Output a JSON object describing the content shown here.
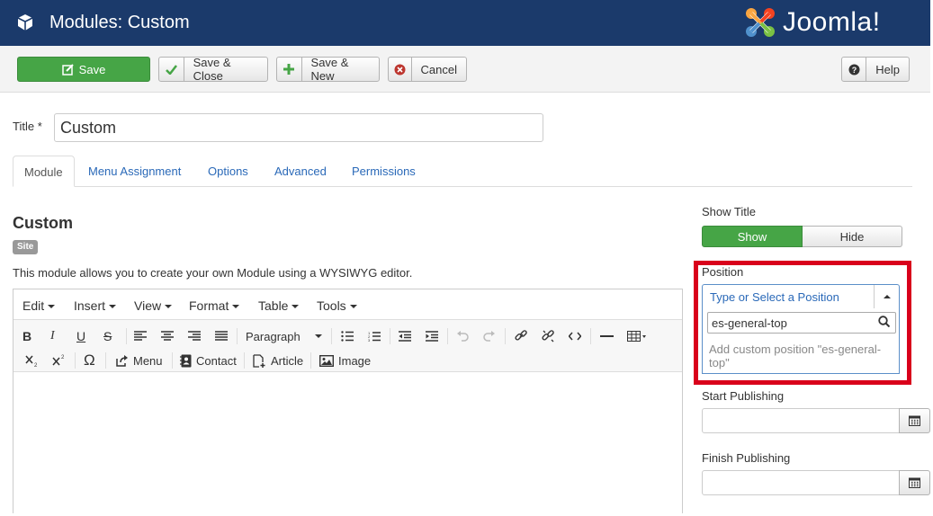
{
  "header": {
    "title": "Modules: Custom",
    "brand": "Joomla!",
    "brand_reg": "®",
    "bg_color": "#1b3a6b"
  },
  "toolbar": {
    "save_label": "Save",
    "save_close_label": "Save & Close",
    "save_new_label": "Save & New",
    "cancel_label": "Cancel",
    "help_label": "Help"
  },
  "form": {
    "title_label": "Title *",
    "title_value": "Custom"
  },
  "tabs": [
    {
      "label": "Module",
      "active": true
    },
    {
      "label": "Menu Assignment",
      "active": false
    },
    {
      "label": "Options",
      "active": false
    },
    {
      "label": "Advanced",
      "active": false
    },
    {
      "label": "Permissions",
      "active": false
    }
  ],
  "module": {
    "heading": "Custom",
    "badge": "Site",
    "description": "This module allows you to create your own Module using a WYSIWYG editor."
  },
  "editor": {
    "menus": [
      "Edit",
      "Insert",
      "View",
      "Format",
      "Table",
      "Tools"
    ],
    "paragraph_select": "Paragraph",
    "insert_buttons": {
      "menu": "Menu",
      "contact": "Contact",
      "article": "Article",
      "image": "Image"
    },
    "body_text": ""
  },
  "sidebar": {
    "show_title_label": "Show Title",
    "show_label": "Show",
    "hide_label": "Hide",
    "position_label": "Position",
    "position_placeholder": "Type or Select a Position",
    "position_search_value": "es-general-top",
    "position_add_option": "Add custom position \"es-general-top\"",
    "start_publishing_label": "Start Publishing",
    "finish_publishing_label": "Finish Publishing"
  },
  "colors": {
    "accent_green": "#46a546",
    "link_blue": "#2a69b8",
    "highlight_red": "#d9001b"
  }
}
